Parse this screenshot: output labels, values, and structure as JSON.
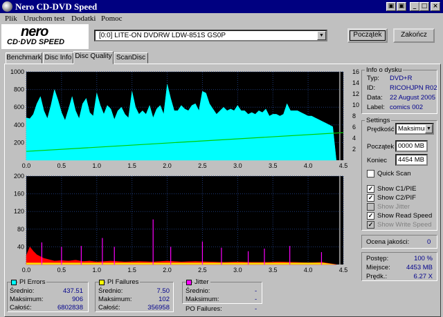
{
  "window": {
    "title": "Nero CD-DVD Speed"
  },
  "window_buttons": [
    "▣",
    "▣",
    "_",
    "□",
    "×"
  ],
  "menu": [
    "Plik",
    "Uruchom test",
    "Dodatki",
    "Pomoc"
  ],
  "logo": {
    "brand": "nero",
    "sub": "CD·DVD SPEED"
  },
  "drive": {
    "selected": "[0:0]  LITE-ON DVDRW LDW-851S GS0P"
  },
  "buttons": {
    "start": "Początek",
    "finish": "Zakończ"
  },
  "tabs": [
    "Benchmark",
    "Disc Info",
    "Disc Quality",
    "ScanDisc"
  ],
  "active_tab": "Disc Quality",
  "disc_info": {
    "header": "Info o dysku",
    "type_label": "Typ:",
    "type_value": "DVD+R",
    "id_label": "ID:",
    "id_value": "RICOHJPN R02",
    "date_label": "Data:",
    "date_value": "22 August 2005",
    "label_label": "Label:",
    "label_value": "comics 002"
  },
  "settings": {
    "header": "Settings",
    "speed_label": "Prędkość",
    "speed_value": "Maksimum",
    "start_label": "Początek",
    "start_value": "0000 MB",
    "end_label": "Koniec",
    "end_value": "4454 MB",
    "quick_scan": "Quick Scan",
    "show_c1": "Show C1/PIE",
    "show_c2": "Show C2/PIF",
    "show_jitter": "Show Jitter",
    "show_read": "Show Read Speed",
    "show_write": "Show Write Speed"
  },
  "quality": {
    "label": "Ocena jakości:",
    "value": "0"
  },
  "progress": {
    "progress_label": "Postęp:",
    "progress_value": "100 %",
    "location_label": "Miejsce:",
    "location_value": "4453 MB",
    "speed_label": "Prędk.:",
    "speed_value": "6.27 X"
  },
  "stats": {
    "pi_errors": {
      "title": "PI Errors",
      "color": "#00ffff",
      "avg_label": "Średnio:",
      "avg": "437.51",
      "max_label": "Maksimum:",
      "max": "906",
      "total_label": "Całość:",
      "total": "6802838"
    },
    "pi_failures": {
      "title": "PI Failures",
      "color": "#ffff00",
      "avg_label": "Średnio:",
      "avg": "7.50",
      "max_label": "Maksimum:",
      "max": "102",
      "total_label": "Całość:",
      "total": "356958"
    },
    "jitter": {
      "title": "Jitter",
      "color": "#ff00ff",
      "avg_label": "Średnio:",
      "avg": "-",
      "max_label": "Maksimum:",
      "max": "-"
    },
    "po_failures": {
      "label": "PO Failures:",
      "value": "-"
    }
  },
  "colors": {
    "pi_errors": "#00ffff",
    "read_speed": "#00cc00",
    "pif": "#ff0000",
    "pif_low": "#ffff00",
    "jitter": "#ff00ff",
    "bg": "#000000"
  },
  "chart_data": [
    {
      "type": "area",
      "title": "PI Errors",
      "x_ticks": [
        "0.0",
        "0.5",
        "1.0",
        "1.5",
        "2.0",
        "2.5",
        "3.0",
        "3.5",
        "4.0",
        "4.5"
      ],
      "y_ticks_left": [
        "1000",
        "800",
        "600",
        "400",
        "200"
      ],
      "y_ticks_right": [
        "16",
        "14",
        "12",
        "10",
        "8",
        "6",
        "4",
        "2"
      ],
      "xlim": [
        0,
        4.5
      ],
      "ylim": [
        0,
        1000
      ],
      "y2lim": [
        0,
        16
      ],
      "series": [
        {
          "name": "PI Errors",
          "color": "#00ffff",
          "x": [
            0.0,
            0.05,
            0.1,
            0.15,
            0.2,
            0.25,
            0.3,
            0.35,
            0.4,
            0.45,
            0.5,
            0.55,
            0.6,
            0.65,
            0.7,
            0.75,
            0.8,
            0.85,
            0.9,
            0.95,
            1.0,
            1.05,
            1.1,
            1.15,
            1.2,
            1.25,
            1.3,
            1.35,
            1.4,
            1.45,
            1.5,
            1.55,
            1.6,
            1.65,
            1.7,
            1.75,
            1.8,
            1.85,
            1.9,
            1.95,
            2.0,
            2.05,
            2.1,
            2.15,
            2.2,
            2.25,
            2.3,
            2.35,
            2.4,
            2.45,
            2.5,
            2.55,
            2.6,
            2.65,
            2.7,
            2.75,
            2.8,
            2.85,
            2.9,
            2.95,
            3.0,
            3.05,
            3.1,
            3.15,
            3.2,
            3.25,
            3.3,
            3.35,
            3.4,
            3.45,
            3.5,
            3.55,
            3.6,
            3.65,
            3.7,
            3.75,
            3.8,
            3.85,
            3.9,
            3.95,
            4.0,
            4.05,
            4.1,
            4.15,
            4.2,
            4.25,
            4.3,
            4.35,
            4.4
          ],
          "y": [
            480,
            470,
            520,
            640,
            720,
            560,
            470,
            620,
            800,
            680,
            540,
            450,
            580,
            720,
            560,
            470,
            640,
            700,
            540,
            500,
            760,
            620,
            520,
            620,
            580,
            460,
            560,
            600,
            520,
            480,
            780,
            600,
            520,
            560,
            520,
            620,
            480,
            580,
            620,
            520,
            860,
            700,
            560,
            560,
            620,
            580,
            560,
            620,
            640,
            560,
            780,
            760,
            640,
            580,
            520,
            560,
            600,
            560,
            580,
            560,
            620,
            560,
            560,
            520,
            540,
            520,
            560,
            540,
            580,
            500,
            520,
            520,
            500,
            520,
            640,
            560,
            560,
            560,
            540,
            520,
            500,
            500,
            480,
            460,
            440,
            420,
            400,
            380,
            0
          ]
        },
        {
          "name": "Read Speed",
          "color": "#00cc00",
          "x": [
            0.0,
            4.5
          ],
          "y": [
            1.6,
            5.0
          ]
        }
      ]
    },
    {
      "type": "area",
      "title": "PI Failures",
      "x_ticks": [
        "0.0",
        "0.5",
        "1.0",
        "1.5",
        "2.0",
        "2.5",
        "3.0",
        "3.5",
        "4.0",
        "4.5"
      ],
      "y_ticks_left": [
        "200",
        "160",
        "120",
        "80",
        "40"
      ],
      "xlim": [
        0,
        4.5
      ],
      "ylim": [
        0,
        200
      ],
      "series": [
        {
          "name": "PI Failures",
          "color": "#ff0000",
          "x": [
            0.0,
            0.05,
            0.1,
            0.15,
            0.2,
            0.25,
            0.3,
            0.35,
            0.4,
            0.5,
            0.6,
            0.7,
            0.8,
            0.9,
            1.0,
            1.2,
            1.4,
            1.6,
            1.8,
            2.0,
            2.2,
            2.4,
            2.6,
            2.8,
            3.0,
            3.2,
            3.4,
            3.6,
            3.8,
            4.0,
            4.2,
            4.4
          ],
          "y": [
            20,
            40,
            30,
            22,
            18,
            14,
            12,
            10,
            8,
            9,
            8,
            10,
            7,
            8,
            6,
            8,
            6,
            7,
            6,
            8,
            6,
            7,
            6,
            5,
            6,
            5,
            5,
            6,
            5,
            4,
            5,
            0
          ]
        }
      ],
      "spikes": [
        {
          "x": 0.22,
          "y": 50
        },
        {
          "x": 0.5,
          "y": 40
        },
        {
          "x": 0.78,
          "y": 42
        },
        {
          "x": 1.08,
          "y": 60
        },
        {
          "x": 1.25,
          "y": 40
        },
        {
          "x": 1.8,
          "y": 102
        },
        {
          "x": 2.05,
          "y": 40
        },
        {
          "x": 2.5,
          "y": 52
        },
        {
          "x": 2.77,
          "y": 38
        },
        {
          "x": 3.15,
          "y": 30
        },
        {
          "x": 3.38,
          "y": 36
        },
        {
          "x": 3.74,
          "y": 42
        },
        {
          "x": 4.19,
          "y": 28
        }
      ]
    }
  ]
}
